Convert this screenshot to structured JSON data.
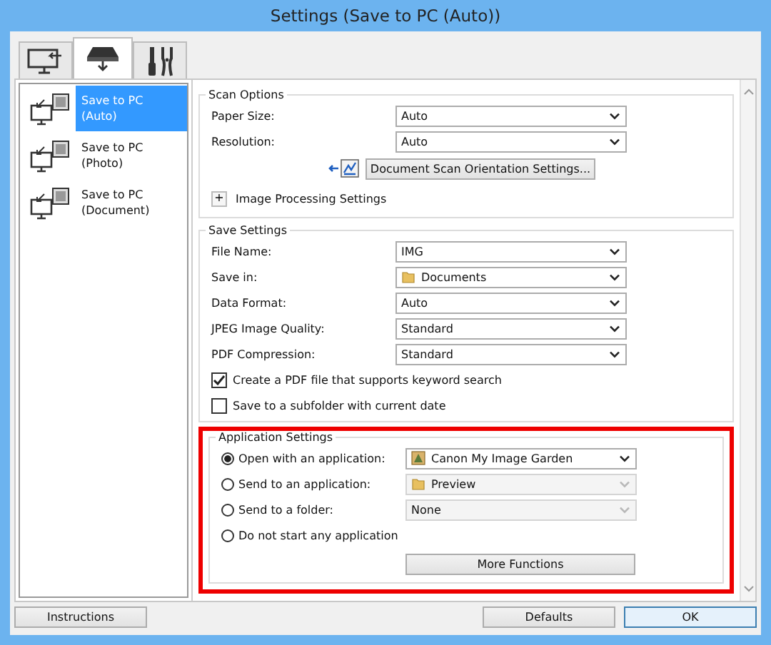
{
  "window": {
    "title": "Settings (Save to PC (Auto))"
  },
  "tabs": [
    {
      "selected": false
    },
    {
      "selected": true
    },
    {
      "selected": false
    }
  ],
  "sidebar": {
    "items": [
      {
        "lines": [
          "Save to PC",
          "(Auto)"
        ],
        "selected": true
      },
      {
        "lines": [
          "Save to PC",
          "(Photo)"
        ],
        "selected": false
      },
      {
        "lines": [
          "Save to PC",
          "(Document)"
        ],
        "selected": false
      }
    ]
  },
  "scan_options": {
    "title": "Scan Options",
    "fields": [
      {
        "label": "Paper Size:",
        "value": "Auto"
      },
      {
        "label": "Resolution:",
        "value": "Auto"
      }
    ],
    "orientation_button": "Document Scan Orientation Settings...",
    "image_processing": {
      "toggle": "+",
      "label": "Image Processing Settings",
      "expanded": false
    }
  },
  "save_settings": {
    "title": "Save Settings",
    "fields": [
      {
        "label": "File Name:",
        "value": "IMG",
        "kind": "combo"
      },
      {
        "label": "Save in:",
        "value": "Documents",
        "kind": "folder"
      },
      {
        "label": "Data Format:",
        "value": "Auto",
        "kind": "combo"
      },
      {
        "label": "JPEG Image Quality:",
        "value": "Standard",
        "kind": "combo"
      },
      {
        "label": "PDF Compression:",
        "value": "Standard",
        "kind": "combo"
      }
    ],
    "checkboxes": [
      {
        "label": "Create a PDF file that supports keyword search",
        "checked": true
      },
      {
        "label": "Save to a subfolder with current date",
        "checked": false
      }
    ]
  },
  "application_settings": {
    "title": "Application Settings",
    "highlighted": true,
    "options": [
      {
        "label": "Open with an application:",
        "selected": true,
        "dropdown": {
          "value": "Canon My Image Garden",
          "kind": "app",
          "disabled": false
        }
      },
      {
        "label": "Send to an application:",
        "selected": false,
        "dropdown": {
          "value": "Preview",
          "kind": "folder",
          "disabled": true
        }
      },
      {
        "label": "Send to a folder:",
        "selected": false,
        "dropdown": {
          "value": "None",
          "kind": "plain",
          "disabled": true
        }
      },
      {
        "label": "Do not start any application",
        "selected": false
      }
    ],
    "more_button": "More Functions"
  },
  "buttons": {
    "instructions": "Instructions",
    "defaults": "Defaults",
    "ok": "OK"
  }
}
